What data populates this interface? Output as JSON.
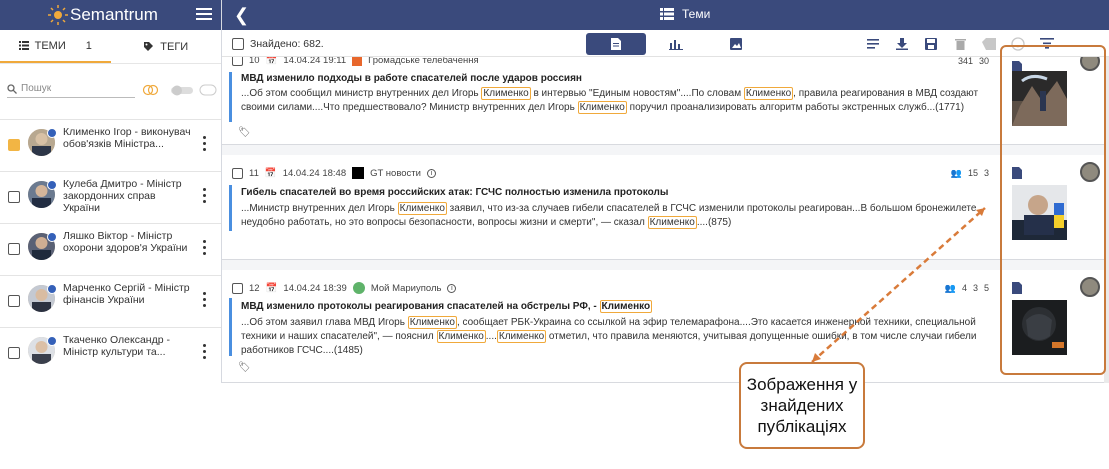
{
  "app": {
    "name": "Semantrum",
    "page_title": "Теми"
  },
  "sidebar": {
    "tabs": [
      {
        "label": "ТЕМИ",
        "count": "1"
      },
      {
        "label": "ТЕГИ"
      }
    ],
    "search_placeholder": "Пошук",
    "entities": [
      {
        "name": "Клименко Ігор - виконувач обов'язків Міністра...",
        "checked": true
      },
      {
        "name": "Кулеба Дмитро - Міністр закордонних справ України",
        "checked": false
      },
      {
        "name": "Ляшко Віктор - Міністр охорони здоров'я України",
        "checked": false
      },
      {
        "name": "Марченко Сергій - Міністр фінансів України",
        "checked": false
      },
      {
        "name": "Ткаченко Олександр - Міністр культури та...",
        "checked": false
      }
    ]
  },
  "toolbar": {
    "found_label": "Знайдено: 682."
  },
  "publications": [
    {
      "num": "10",
      "date": "14.04.24 19:11",
      "source": "Громадське телебачення",
      "stats": {
        "authors": "341",
        "mv": "30"
      },
      "headline": "МВД изменило подходы в работе спасателей после ударов россиян",
      "body_parts": [
        "...Об этом сообщил министр внутренних дел Игорь ",
        "Клименко",
        " в интервью \"Единым новостям\"....По словам ",
        "Клименко",
        ", правила реагирования в МВД создают",
        " своими силами....Что предшествовало? Министр внутренних дел Игорь ",
        "Клименко",
        " поручил проанализировать алгоритм работы экстренных служб...(1771)"
      ]
    },
    {
      "num": "11",
      "date": "14.04.24 18:48",
      "source": "GT новости",
      "stats": {
        "authors": "15",
        "mv": "3"
      },
      "headline": "Гибель спасателей во время российских атак: ГСЧС полностью изменила протоколы",
      "body_parts": [
        "...Министр внутренних дел Игорь ",
        "Клименко",
        " заявил, что из-за случаев гибели спасателей в ГСЧС изменили протоколы реагирован...В большом бронежилете",
        " неудобно работать, но это вопросы безопасности, вопросы жизни и смерти\", — сказал ",
        "Клименко",
        "....(875)"
      ]
    },
    {
      "num": "12",
      "date": "14.04.24 18:39",
      "source": "Мой Мариуполь",
      "stats": {
        "authors": "4",
        "mv": "3",
        "docs": "5"
      },
      "headline": "МВД изменило протоколы реагирования спасателей на обстрелы РФ, - ",
      "headline_hl": "Клименко",
      "body_parts": [
        "...Об этом заявил глава МВД Игорь ",
        "Клименко",
        ", сообщает РБК-Украина со ссылкой на эфир телемарафона....Это касается инженерной техники, специальной",
        " техники и наших спасателей\", — пояснил ",
        "Клименко",
        "....",
        "Клименко",
        " отметил, что правила меняются, учитывая допущенные ошибки, в том числе случаи гибели",
        " работников ГСЧС....(1485)"
      ]
    }
  ],
  "callout": {
    "text": "Зображення у знайдених публікаціях"
  },
  "colors": {
    "header": "#3a4a7c",
    "accent": "#f0a93b",
    "callout_border": "#c87a3c",
    "bar": "#4a8fe0"
  }
}
